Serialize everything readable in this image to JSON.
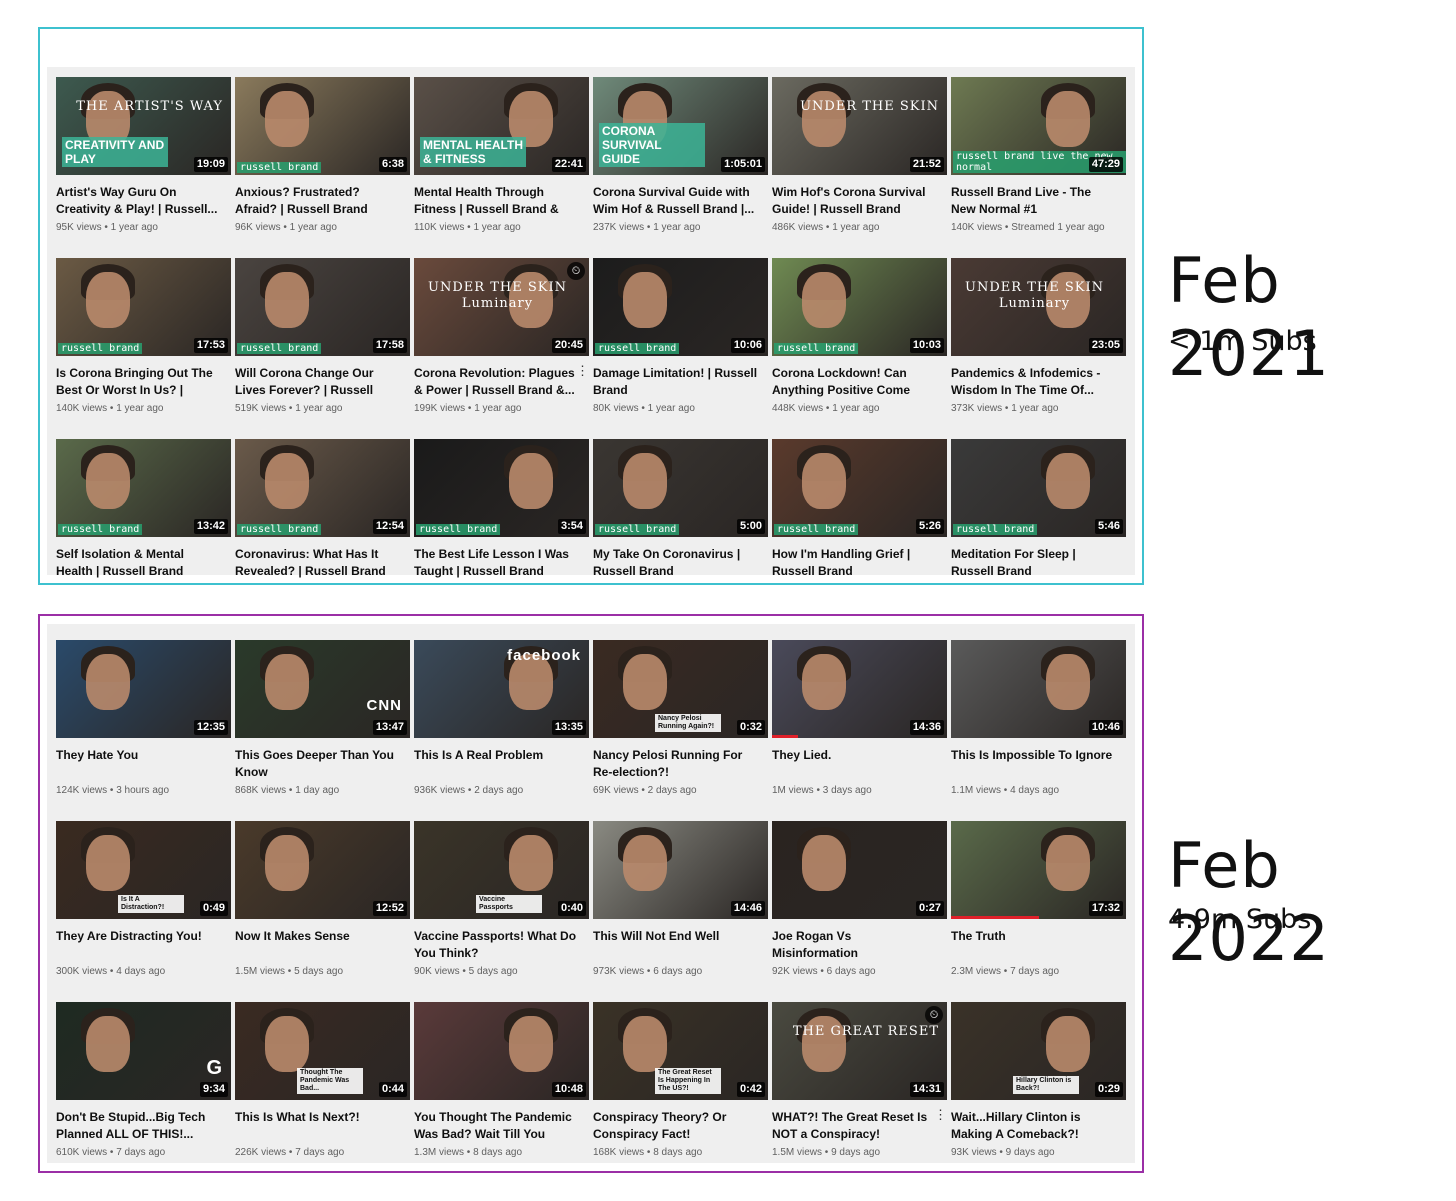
{
  "labels": {
    "year_2021": "Feb 2021",
    "subs_2021": "< 1m Subs",
    "year_2022": "Feb 2022",
    "subs_2022": "4.9m Subs"
  },
  "colors": {
    "border_2021": "#3ec1cf",
    "border_2022": "#9b2fa6",
    "grid_bg": "#efefef"
  },
  "feb2021": [
    {
      "title": "Artist's Way Guru On Creativity & Play! | Russell...",
      "views": "95K views",
      "age": "1 year ago",
      "duration": "19:09",
      "overlay": "CREATIVITY AND PLAY",
      "right": "THE ARTIST'S WAY",
      "tone": "#3d5a4f"
    },
    {
      "title": "Anxious? Frustrated? Afraid? | Russell Brand",
      "views": "96K views",
      "age": "1 year ago",
      "duration": "6:38",
      "brand": "russell brand",
      "tone": "#8a7a5c"
    },
    {
      "title": "Mental Health Through Fitness | Russell Brand & Jo...",
      "views": "110K views",
      "age": "1 year ago",
      "duration": "22:41",
      "overlay": "MENTAL HEALTH & FITNESS",
      "tone": "#5a5048"
    },
    {
      "title": "Corona Survival Guide with Wim Hof & Russell Brand |...",
      "views": "237K views",
      "age": "1 year ago",
      "duration": "1:05:01",
      "overlay": "CORONA SURVIVAL GUIDE",
      "tone": "#6f8a7a"
    },
    {
      "title": "Wim Hof's Corona Survival Guide! | Russell Brand",
      "views": "486K views",
      "age": "1 year ago",
      "duration": "21:52",
      "right": "UNDER THE SKIN",
      "tone": "#6b6a60"
    },
    {
      "title": "Russell Brand Live - The New Normal #1",
      "views": "140K views",
      "age": "Streamed 1 year ago",
      "duration": "47:29",
      "brand": "russell brand live the new normal",
      "tone": "#6e7a52"
    },
    {
      "title": "Is Corona Bringing Out The Best Or Worst In Us? | Russ...",
      "views": "140K views",
      "age": "1 year ago",
      "duration": "17:53",
      "brand": "russell brand",
      "tone": "#6b5a44"
    },
    {
      "title": "Will Corona Change Our Lives Forever? | Russell Brand",
      "views": "519K views",
      "age": "1 year ago",
      "duration": "17:58",
      "brand": "russell brand",
      "tone": "#4a4440"
    },
    {
      "title": "Corona Revolution: Plagues & Power | Russell Brand &...",
      "views": "199K views",
      "age": "1 year ago",
      "duration": "20:45",
      "right": "UNDER THE SKIN Luminary",
      "tone": "#6a4a3c",
      "clock": true,
      "kebab": true
    },
    {
      "title": "Damage Limitation! | Russell Brand",
      "views": "80K views",
      "age": "1 year ago",
      "duration": "10:06",
      "brand": "russell brand",
      "tone": "#1c1c1c"
    },
    {
      "title": "Corona Lockdown! Can Anything Positive Come Fro...",
      "views": "448K views",
      "age": "1 year ago",
      "duration": "10:03",
      "brand": "russell brand",
      "tone": "#6f8a52"
    },
    {
      "title": "Pandemics & Infodemics - Wisdom In The Time Of...",
      "views": "373K views",
      "age": "1 year ago",
      "duration": "23:05",
      "right": "UNDER THE SKIN Luminary",
      "tone": "#4a3a34"
    },
    {
      "title": "Self Isolation & Mental Health | Russell Brand",
      "views": "",
      "age": "",
      "duration": "13:42",
      "brand": "russell brand",
      "tone": "#5a6a4a"
    },
    {
      "title": "Coronavirus: What Has It Revealed? | Russell Brand",
      "views": "",
      "age": "",
      "duration": "12:54",
      "brand": "russell brand",
      "tone": "#6a5a4a"
    },
    {
      "title": "The Best Life Lesson I Was Taught | Russell Brand",
      "views": "",
      "age": "",
      "duration": "3:54",
      "brand": "russell brand",
      "tone": "#1a1a1a"
    },
    {
      "title": "My Take On Coronavirus | Russell Brand",
      "views": "",
      "age": "",
      "duration": "5:00",
      "brand": "russell brand",
      "tone": "#3a3632"
    },
    {
      "title": "How I'm Handling Grief | Russell Brand",
      "views": "",
      "age": "",
      "duration": "5:26",
      "brand": "russell brand",
      "tone": "#5a3a2c"
    },
    {
      "title": "Meditation For Sleep | Russell Brand",
      "views": "",
      "age": "",
      "duration": "5:46",
      "brand": "russell brand",
      "tone": "#3a3a3a"
    }
  ],
  "feb2022": [
    {
      "title": "They Hate You",
      "views": "124K views",
      "age": "3 hours ago",
      "duration": "12:35",
      "tone": "#2a4a6a"
    },
    {
      "title": "This Goes Deeper Than You Know",
      "views": "868K views",
      "age": "1 day ago",
      "duration": "13:47",
      "tone": "#2a3a2a",
      "logo": "CNN"
    },
    {
      "title": "This Is A Real Problem",
      "views": "936K views",
      "age": "2 days ago",
      "duration": "13:35",
      "tone": "#3a4a5a",
      "logo": "facebook"
    },
    {
      "title": "Nancy Pelosi Running For Re-election?!",
      "views": "69K views",
      "age": "2 days ago",
      "duration": "0:32",
      "tone": "#3a2a22",
      "caption": "Nancy Pelosi Running Again?!"
    },
    {
      "title": "They Lied.",
      "views": "1M views",
      "age": "3 days ago",
      "duration": "14:36",
      "tone": "#4a4a5a",
      "progress": 0.15
    },
    {
      "title": "This Is Impossible To Ignore",
      "views": "1.1M views",
      "age": "4 days ago",
      "duration": "10:46",
      "tone": "#5a5a5a"
    },
    {
      "title": "They Are Distracting You!",
      "views": "300K views",
      "age": "4 days ago",
      "duration": "0:49",
      "tone": "#3a2a20",
      "caption": "Is It A Distraction?!"
    },
    {
      "title": "Now It Makes Sense",
      "views": "1.5M views",
      "age": "5 days ago",
      "duration": "12:52",
      "tone": "#4a3a2a"
    },
    {
      "title": "Vaccine Passports! What Do You Think?",
      "views": "90K views",
      "age": "5 days ago",
      "duration": "0:40",
      "tone": "#3a3428",
      "caption": "Vaccine Passports"
    },
    {
      "title": "This Will Not End Well",
      "views": "973K views",
      "age": "6 days ago",
      "duration": "14:46",
      "tone": "#8a8a82"
    },
    {
      "title": "Joe Rogan Vs Misinformation",
      "views": "92K views",
      "age": "6 days ago",
      "duration": "0:27",
      "tone": "#2a2420"
    },
    {
      "title": "The Truth",
      "views": "2.3M views",
      "age": "7 days ago",
      "duration": "17:32",
      "tone": "#5a6a4a",
      "progress": 0.5
    },
    {
      "title": "Don't Be Stupid...Big Tech Planned ALL OF THIS!...",
      "views": "610K views",
      "age": "7 days ago",
      "duration": "9:34",
      "tone": "#1e2a22",
      "logo": "G"
    },
    {
      "title": "This Is What Is Next?!",
      "views": "226K views",
      "age": "7 days ago",
      "duration": "0:44",
      "tone": "#3a2a22",
      "caption": "Thought The Pandemic Was Bad..."
    },
    {
      "title": "You Thought The Pandemic Was Bad? Wait Till You See...",
      "views": "1.3M views",
      "age": "8 days ago",
      "duration": "10:48",
      "tone": "#5a3a3a"
    },
    {
      "title": "Conspiracy Theory? Or Conspiracy Fact!",
      "views": "168K views",
      "age": "8 days ago",
      "duration": "0:42",
      "tone": "#3a3226",
      "caption": "The Great Reset Is Happening In The US?!"
    },
    {
      "title": "WHAT?! The Great Reset Is NOT a Conspiracy!",
      "views": "1.5M views",
      "age": "9 days ago",
      "duration": "14:31",
      "tone": "#4a4a40",
      "right": "THE GREAT RESET",
      "clock": true,
      "kebab": true
    },
    {
      "title": "Wait...Hillary Clinton is Making A Comeback?!",
      "views": "93K views",
      "age": "9 days ago",
      "duration": "0:29",
      "tone": "#3a3228",
      "caption": "Hillary Clinton is Back?!"
    }
  ]
}
